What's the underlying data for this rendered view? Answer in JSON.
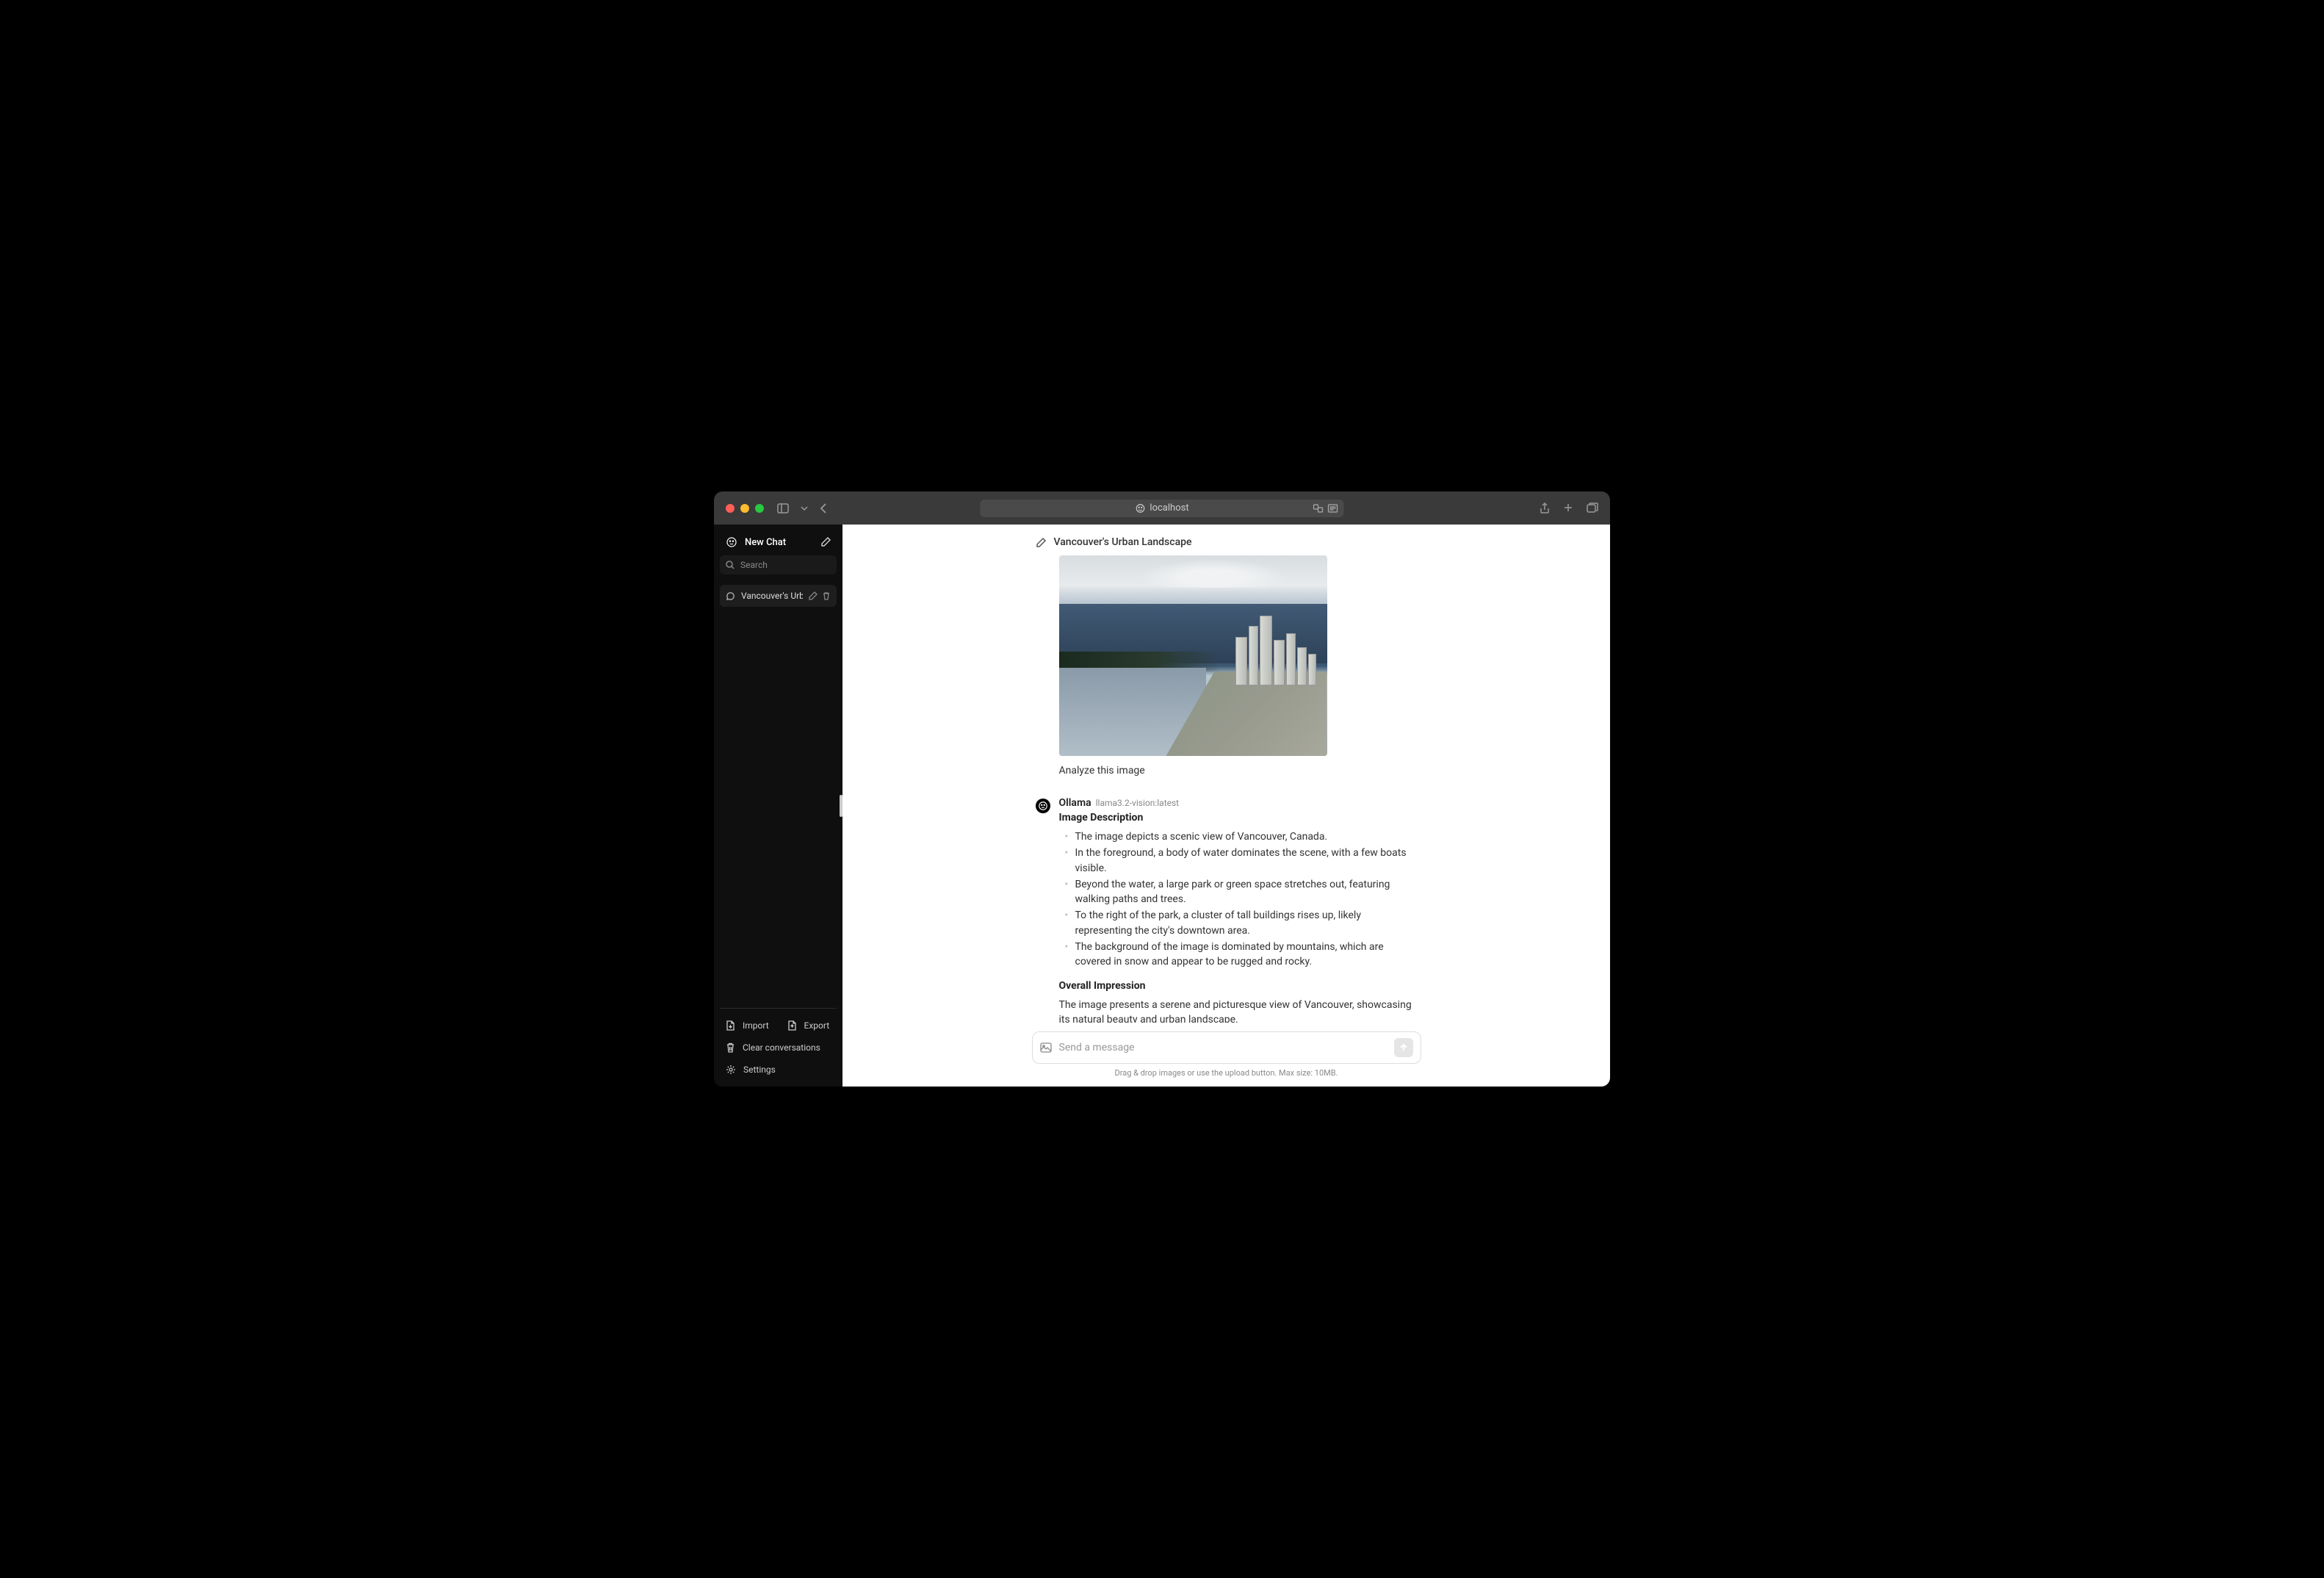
{
  "browser": {
    "url": "localhost"
  },
  "sidebar": {
    "new_chat_label": "New Chat",
    "search_placeholder": "Search",
    "chat_items": [
      {
        "title": "Vancouver's Urban"
      }
    ],
    "import_label": "Import",
    "export_label": "Export",
    "clear_label": "Clear conversations",
    "settings_label": "Settings"
  },
  "chat": {
    "title": "Vancouver's Urban Landscape",
    "user_prompt": "Analyze this image",
    "assistant": {
      "name": "Ollama",
      "model": "llama3.2-vision:latest",
      "section1_heading": "Image Description",
      "bullets": [
        "The image depicts a scenic view of Vancouver, Canada.",
        "In the foreground, a body of water dominates the scene, with a few boats visible.",
        "Beyond the water, a large park or green space stretches out, featuring walking paths and trees.",
        "To the right of the park, a cluster of tall buildings rises up, likely representing the city's downtown area.",
        "The background of the image is dominated by mountains, which are covered in snow and appear to be rugged and rocky."
      ],
      "section2_heading": "Overall Impression",
      "paragraph": "The image presents a serene and picturesque view of Vancouver, showcasing its natural beauty and urban landscape."
    }
  },
  "input": {
    "placeholder": "Send a message",
    "hint": "Drag & drop images or use the upload button. Max size: 10MB."
  }
}
